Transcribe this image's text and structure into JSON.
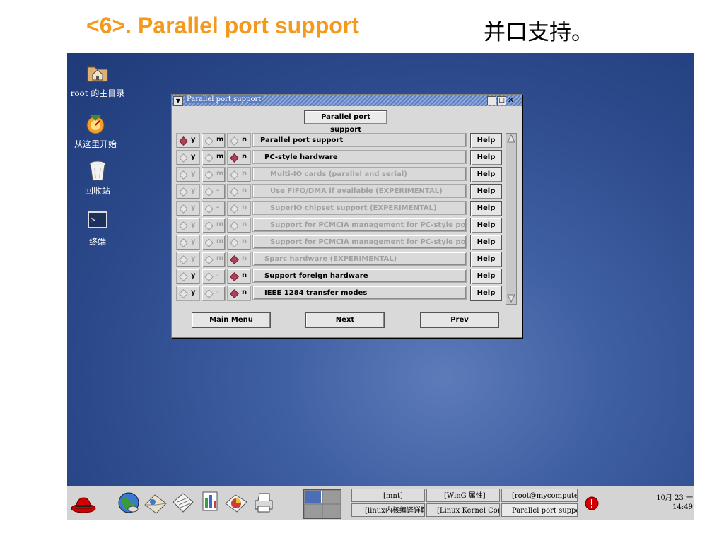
{
  "slide": {
    "title": "<6>. Parallel port support",
    "title_cn": "并口支持。"
  },
  "desktop": {
    "icons": [
      {
        "label": "root 的主目录",
        "icon": "home-folder-icon"
      },
      {
        "label": "从这里开始",
        "icon": "start-here-icon"
      },
      {
        "label": "回收站",
        "icon": "trash-icon"
      },
      {
        "label": "终端",
        "icon": "terminal-icon"
      }
    ]
  },
  "window": {
    "title": "Parallel port support",
    "header_button": "Parallel port support",
    "rows": [
      {
        "y": "y",
        "m": "m",
        "n": "n",
        "selected": "y",
        "label": "Parallel port support",
        "dim": false,
        "m_dim": false
      },
      {
        "y": "y",
        "m": "m",
        "n": "n",
        "selected": "n",
        "label": "PC-style hardware",
        "dim": false,
        "m_dim": false
      },
      {
        "y": "y",
        "m": "m",
        "n": "n",
        "selected": "none",
        "label": "Multi-IO cards (parallel and serial)",
        "dim": true,
        "m_dim": true
      },
      {
        "y": "y",
        "m": "-",
        "n": "n",
        "selected": "none",
        "label": "Use FIFO/DMA if available (EXPERIMENTAL)",
        "dim": true,
        "m_dim": true
      },
      {
        "y": "y",
        "m": "-",
        "n": "n",
        "selected": "none",
        "label": "SuperIO chipset support (EXPERIMENTAL)",
        "dim": true,
        "m_dim": true
      },
      {
        "y": "y",
        "m": "m",
        "n": "n",
        "selected": "none",
        "label": "Support for PCMCIA management for PC-style ports",
        "dim": true,
        "m_dim": true
      },
      {
        "y": "y",
        "m": "m",
        "n": "n",
        "selected": "none",
        "label": "Support for PCMCIA management for PC-style ports",
        "dim": true,
        "m_dim": true
      },
      {
        "y": "y",
        "m": "m",
        "n": "n",
        "selected": "n",
        "label": "Sparc hardware (EXPERIMENTAL)",
        "dim": true,
        "m_dim": true
      },
      {
        "y": "y",
        "m": "-",
        "n": "n",
        "selected": "n",
        "label": "Support foreign hardware",
        "dim": false,
        "m_dim": true
      },
      {
        "y": "y",
        "m": "-",
        "n": "n",
        "selected": "n",
        "label": "IEEE 1284 transfer modes",
        "dim": false,
        "m_dim": true
      }
    ],
    "help_label": "Help",
    "buttons": {
      "main_menu": "Main Menu",
      "next": "Next",
      "prev": "Prev"
    }
  },
  "taskbar": {
    "tasks_row1": [
      "[mnt]",
      "[WinG 属性]",
      "[root@mycomputer:/"
    ],
    "tasks_row2": [
      "[linux内核编译详解",
      "[Linux Kernel Con",
      "Parallel port suppor"
    ],
    "clock_date": "10月 23 一",
    "clock_time": "14:49"
  },
  "colors": {
    "title_orange": "#f39a1e",
    "desktop_blue": "#3f60a4",
    "selected_diamond": "#b0405a"
  }
}
